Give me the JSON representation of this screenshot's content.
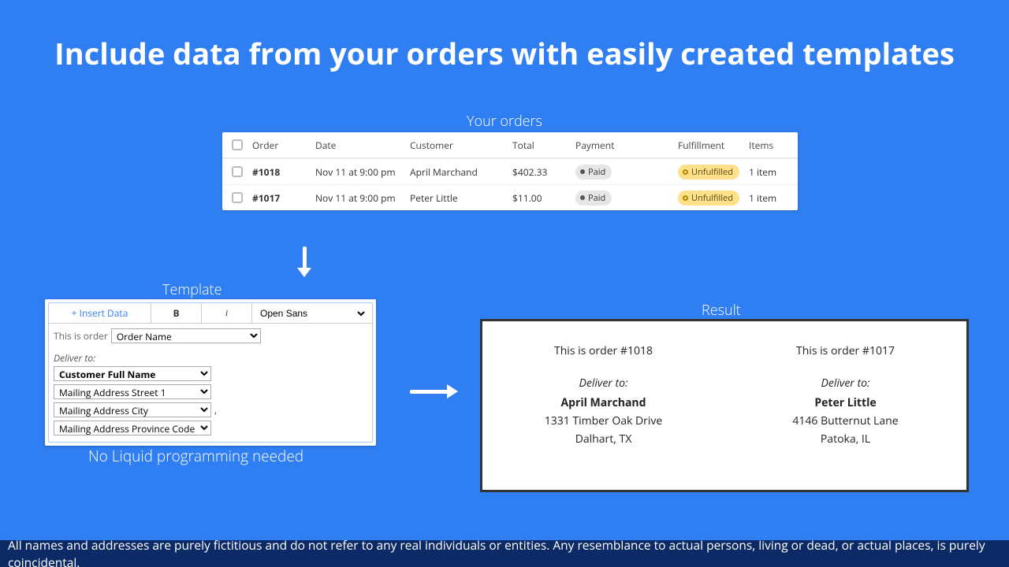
{
  "heading": "Include data from your orders with easily created templates",
  "labels": {
    "your_orders": "Your orders",
    "template": "Template",
    "result": "Result",
    "no_liquid": "No Liquid programming needed"
  },
  "orders": {
    "headers": {
      "order": "Order",
      "date": "Date",
      "customer": "Customer",
      "total": "Total",
      "payment": "Payment",
      "fulfillment": "Fulfillment",
      "items": "Items"
    },
    "rows": [
      {
        "order": "#1018",
        "date": "Nov 11 at 9:00 pm",
        "customer": "April Marchand",
        "total": "$402.33",
        "payment": "Paid",
        "fulfillment": "Unfulfilled",
        "items": "1 item"
      },
      {
        "order": "#1017",
        "date": "Nov 11 at 9:00 pm",
        "customer": "Peter Little",
        "total": "$11.00",
        "payment": "Paid",
        "fulfillment": "Unfulfilled",
        "items": "1 item"
      }
    ]
  },
  "template": {
    "toolbar": {
      "insert": "+ Insert Data",
      "bold": "B",
      "italic": "i",
      "font": "Open Sans"
    },
    "body": {
      "prefix": "This is order",
      "order_field": "Order Name",
      "deliver_label": "Deliver to:",
      "fullname_field": "Customer Full Name",
      "street_field": "Mailing Address Street 1",
      "city_field": "Mailing Address City",
      "province_field": "Mailing Address Province Code",
      "comma": ","
    }
  },
  "result": {
    "cols": [
      {
        "order_line": "This is order #1018",
        "deliver": "Deliver to:",
        "name": "April Marchand",
        "street": "1331 Timber Oak Drive",
        "city": "Dalhart, TX"
      },
      {
        "order_line": "This is order #1017",
        "deliver": "Deliver to:",
        "name": "Peter Little",
        "street": "4146  Butternut Lane",
        "city": "Patoka, IL"
      }
    ]
  },
  "footer": "All names and addresses are purely fictitious and do not refer to any real individuals or entities. Any resemblance to actual persons, living or dead, or actual places, is purely coincidental."
}
